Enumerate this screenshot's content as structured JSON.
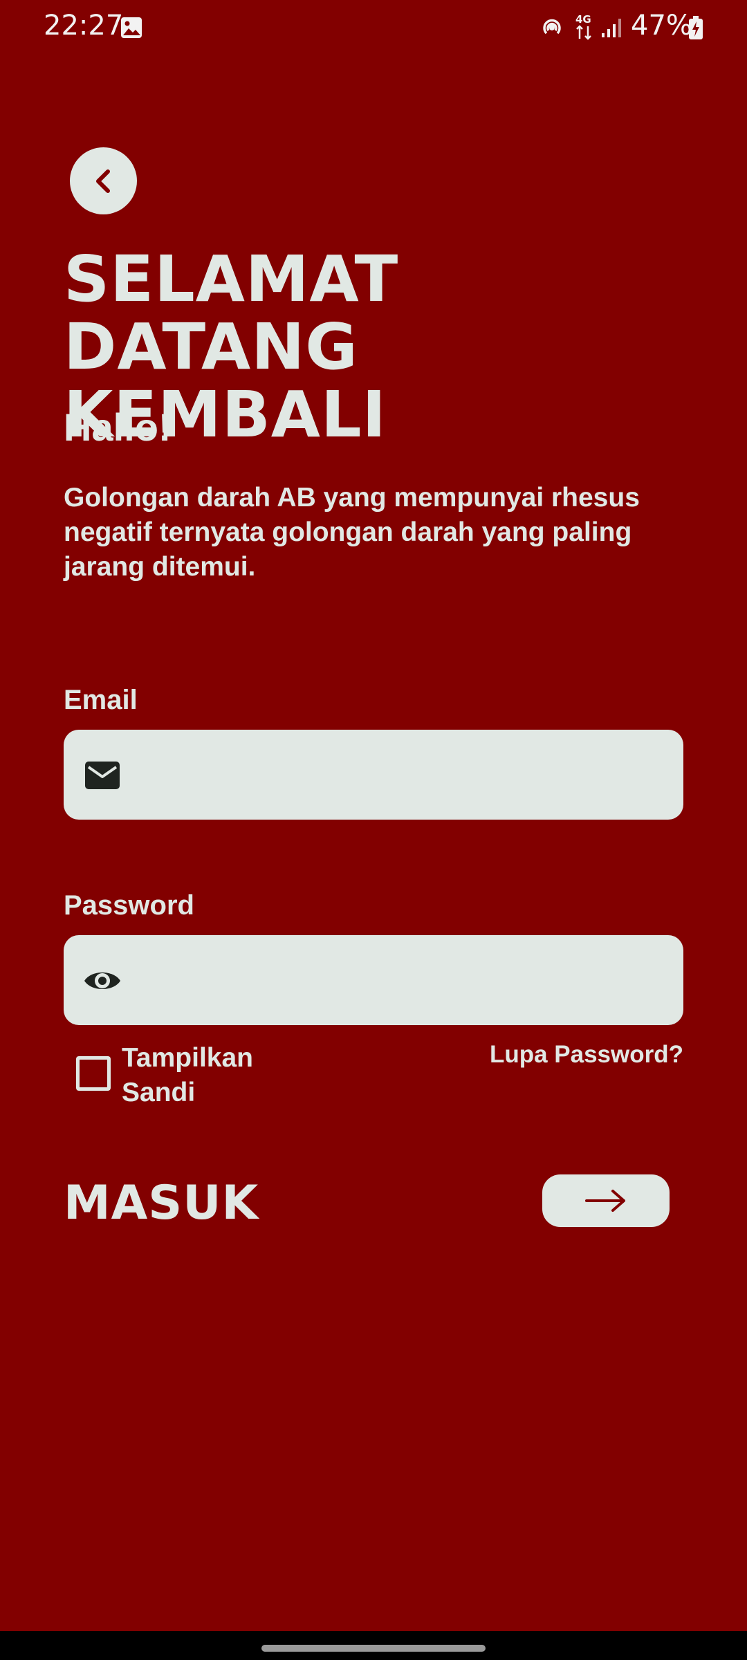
{
  "status_bar": {
    "time": "22:27",
    "battery": "47%",
    "network": "4G",
    "icons": [
      "gallery-icon",
      "hotspot-icon",
      "4g-icon",
      "signal-icon",
      "battery-charging-icon"
    ]
  },
  "header": {
    "back_icon": "chevron-left-icon",
    "headline": "SELAMAT DATANG\nKEMBALI",
    "greeting": "Hallo!",
    "description": "Golongan darah AB yang mempunyai rhesus negatif ternyata golongan darah yang paling jarang ditemui."
  },
  "form": {
    "email_label": "Email",
    "email_value": "",
    "email_icon": "mail-icon",
    "password_label": "Password",
    "password_value": "",
    "password_icon": "eye-icon",
    "show_password_label": "Tampilkan Sandi",
    "show_password_checked": false,
    "forgot_password": "Lupa Password?",
    "submit_label": "MASUK",
    "submit_icon": "arrow-right-icon"
  },
  "colors": {
    "background": "#820000",
    "surface": "#e1e8e4",
    "icon_dark": "#1f2420"
  }
}
